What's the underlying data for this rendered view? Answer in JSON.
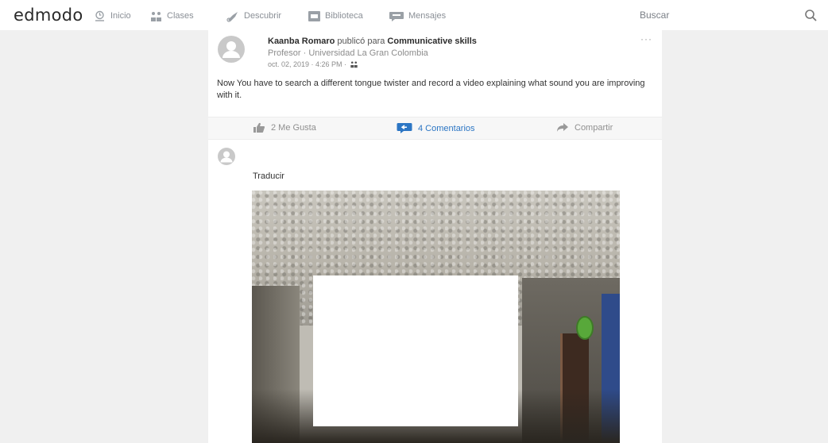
{
  "header": {
    "logo": "edmodo",
    "nav": [
      {
        "label": "Inicio",
        "icon": "home-icon"
      },
      {
        "label": "Clases",
        "icon": "classes-icon"
      },
      {
        "label": "Descubrir",
        "icon": "rocket-icon"
      },
      {
        "label": "Biblioteca",
        "icon": "library-icon"
      },
      {
        "label": "Mensajes",
        "icon": "messages-icon"
      }
    ],
    "search_placeholder": "Buscar"
  },
  "post": {
    "author": "Kaanba Romaro",
    "posted_for": "publicó para",
    "group": "Communicative skills",
    "role": "Profesor · Universidad La Gran Colombia",
    "date": "oct. 02, 2019 · 4:26 PM ·",
    "more": "···",
    "body": "Now  You have to search a different tongue twister and record a video explaining what sound you are improving with it.",
    "likes": "2 Me Gusta",
    "comments": "4 Comentarios",
    "share": "Compartir"
  },
  "comment": {
    "translate": "Traducir"
  },
  "colors": {
    "accent": "#2c76c4",
    "muted": "#8a8f96",
    "background": "#f0f0f0"
  }
}
